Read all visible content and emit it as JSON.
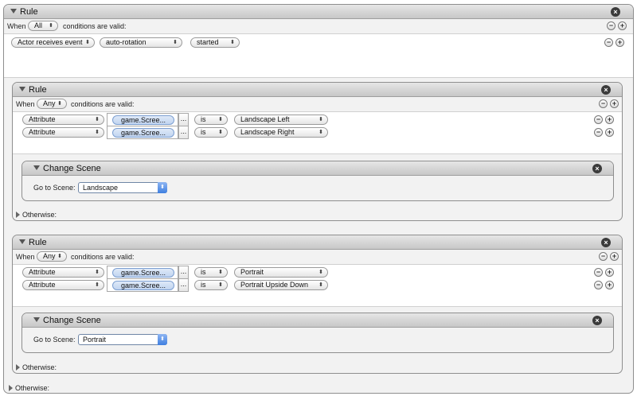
{
  "outer_rule": {
    "title": "Rule",
    "when_label": "When",
    "match": "All",
    "conditions_label": "conditions are valid:",
    "condition": {
      "type": "Actor receives event",
      "event": "auto-rotation",
      "state": "started"
    },
    "otherwise_label": "Otherwise:"
  },
  "rule_landscape": {
    "title": "Rule",
    "when_label": "When",
    "match": "Any",
    "conditions_label": "conditions are valid:",
    "conditions": [
      {
        "type": "Attribute",
        "attribute": "game.Scree...",
        "dots": "...",
        "op": "is",
        "value": "Landscape Left"
      },
      {
        "type": "Attribute",
        "attribute": "game.Scree...",
        "dots": "...",
        "op": "is",
        "value": "Landscape Right"
      }
    ],
    "behavior": {
      "title": "Change Scene",
      "go_label": "Go to Scene:",
      "scene": "Landscape"
    },
    "otherwise_label": "Otherwise:"
  },
  "rule_portrait": {
    "title": "Rule",
    "when_label": "When",
    "match": "Any",
    "conditions_label": "conditions are valid:",
    "conditions": [
      {
        "type": "Attribute",
        "attribute": "game.Scree...",
        "dots": "...",
        "op": "is",
        "value": "Portrait"
      },
      {
        "type": "Attribute",
        "attribute": "game.Scree...",
        "dots": "...",
        "op": "is",
        "value": "Portrait Upside Down"
      }
    ],
    "behavior": {
      "title": "Change Scene",
      "go_label": "Go to Scene:",
      "scene": "Portrait"
    },
    "otherwise_label": "Otherwise:"
  },
  "icons": {
    "close": "×",
    "minus": "−",
    "plus": "+",
    "popup_arrows": "⬍",
    "disclosure_down": "collapse-triangle-icon",
    "disclosure_right": "expand-triangle-icon"
  }
}
